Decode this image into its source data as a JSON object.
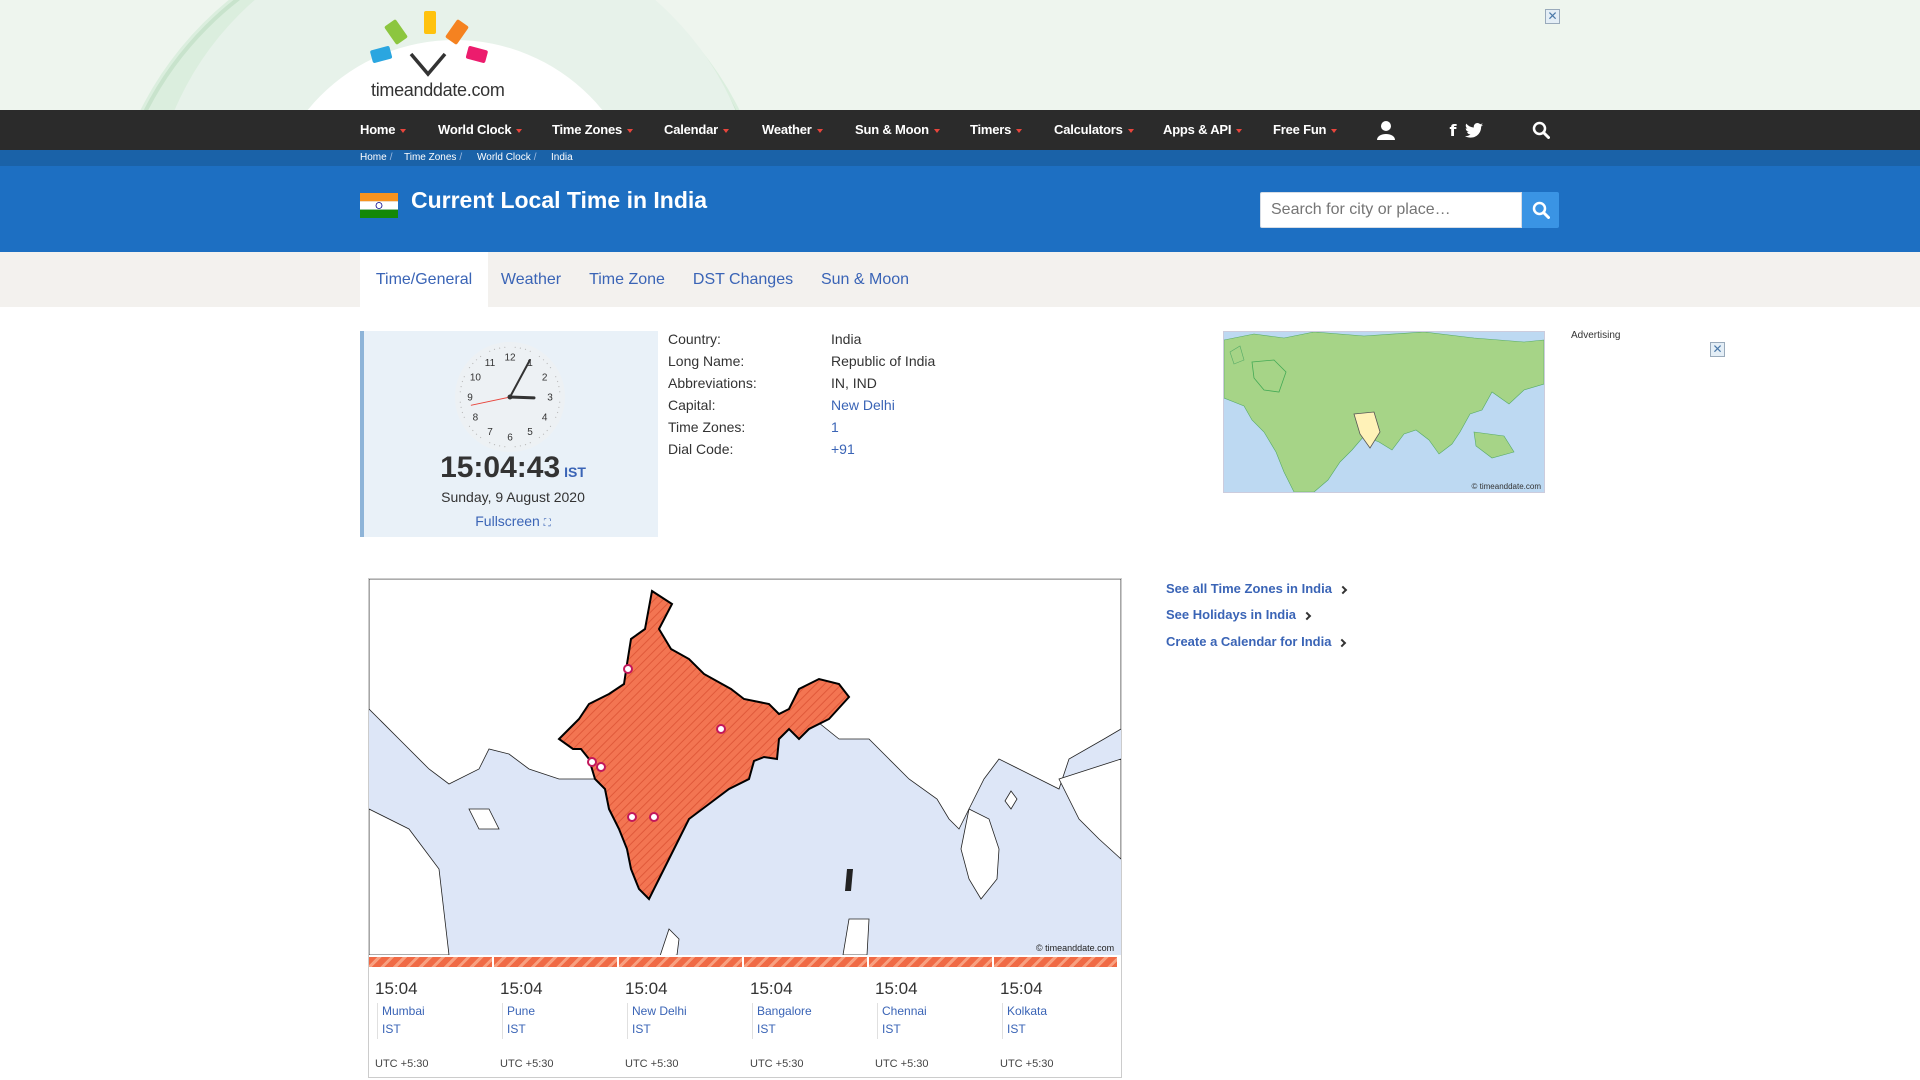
{
  "logo": {
    "text": "timeanddate.com"
  },
  "nav": {
    "items": [
      {
        "label": "Home"
      },
      {
        "label": "World Clock"
      },
      {
        "label": "Time Zones"
      },
      {
        "label": "Calendar"
      },
      {
        "label": "Weather"
      },
      {
        "label": "Sun & Moon"
      },
      {
        "label": "Timers"
      },
      {
        "label": "Calculators"
      },
      {
        "label": "Apps & API"
      },
      {
        "label": "Free Fun"
      }
    ],
    "icons": [
      "user-icon",
      "facebook-icon",
      "twitter-icon",
      "search-icon"
    ]
  },
  "breadcrumb": [
    "Home",
    "Time Zones",
    "World Clock",
    "India"
  ],
  "header": {
    "title": "Current Local Time in India",
    "search_placeholder": "Search for city or place…"
  },
  "tabs": [
    {
      "label": "Time/General",
      "active": true
    },
    {
      "label": "Weather"
    },
    {
      "label": "Time Zone"
    },
    {
      "label": "DST Changes"
    },
    {
      "label": "Sun & Moon"
    }
  ],
  "clock": {
    "time": "15:04:43",
    "tz": "IST",
    "date": "Sunday, 9 August 2020",
    "fullscreen": "Fullscreen",
    "numerals": [
      "12",
      "1",
      "2",
      "3",
      "4",
      "5",
      "6",
      "7",
      "8",
      "9",
      "10",
      "11"
    ]
  },
  "info": [
    {
      "label": "Country:",
      "value": "India",
      "link": false
    },
    {
      "label": "Long Name:",
      "value": "Republic of India",
      "link": false
    },
    {
      "label": "Abbreviations:",
      "value": "IN, IND",
      "link": false
    },
    {
      "label": "Capital:",
      "value": "New Delhi",
      "link": true
    },
    {
      "label": "Time Zones:",
      "value": "1",
      "link": true
    },
    {
      "label": "Dial Code:",
      "value": "+91",
      "link": true
    }
  ],
  "world_map": {
    "copyright": "© timeanddate.com"
  },
  "advertising": {
    "label": "Advertising"
  },
  "map": {
    "copyright": "© timeanddate.com"
  },
  "cities": [
    {
      "time": "15:04",
      "name": "Mumbai",
      "tz": "IST",
      "utc": "UTC +5:30"
    },
    {
      "time": "15:04",
      "name": "Pune",
      "tz": "IST",
      "utc": "UTC +5:30"
    },
    {
      "time": "15:04",
      "name": "New Delhi",
      "tz": "IST",
      "utc": "UTC +5:30"
    },
    {
      "time": "15:04",
      "name": "Bangalore",
      "tz": "IST",
      "utc": "UTC +5:30"
    },
    {
      "time": "15:04",
      "name": "Chennai",
      "tz": "IST",
      "utc": "UTC +5:30"
    },
    {
      "time": "15:04",
      "name": "Kolkata",
      "tz": "IST",
      "utc": "UTC +5:30"
    }
  ],
  "side_links": [
    "See all Time Zones in India",
    "See Holidays in India",
    "Create a Calendar for India"
  ],
  "colors": {
    "nav_bg": "#2b2b2b",
    "header_blue": "#1d6fc2",
    "link": "#3a64b6",
    "india_fill": "#f06a45"
  }
}
